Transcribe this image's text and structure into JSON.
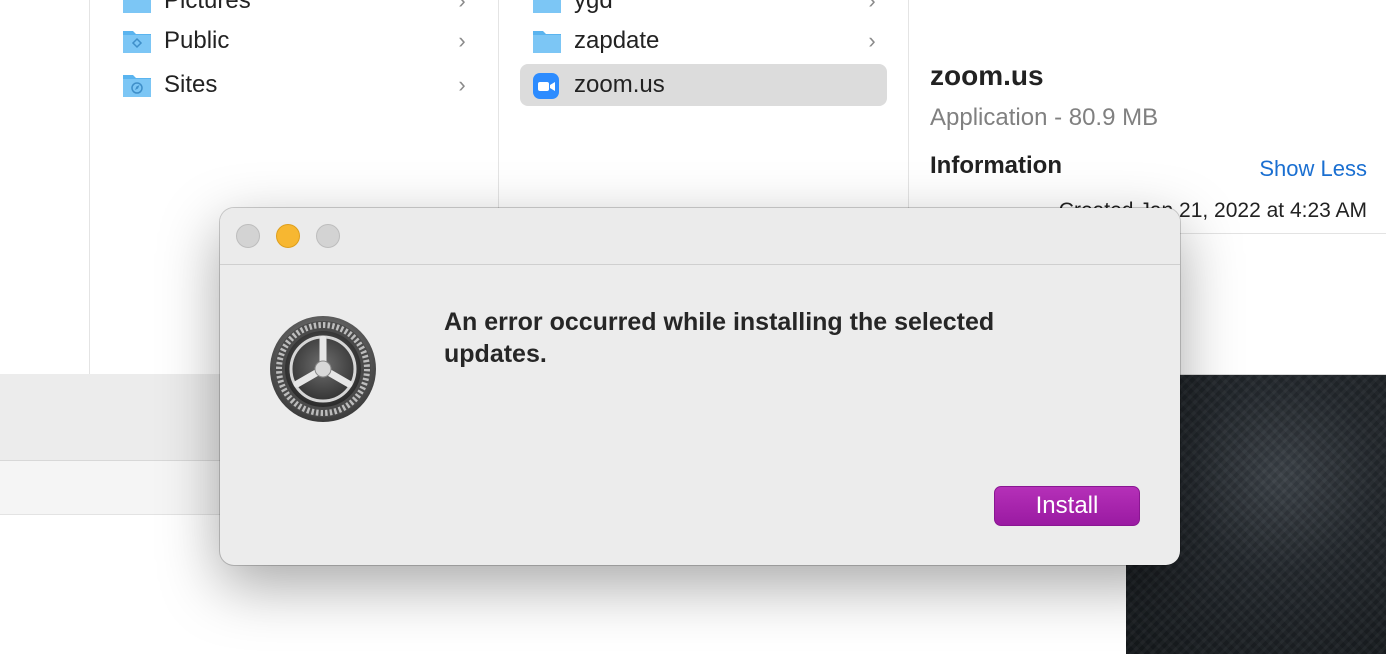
{
  "finder": {
    "column2": {
      "items": [
        {
          "label": "Pictures",
          "icon": "pictures-folder-icon"
        },
        {
          "label": "Public",
          "icon": "public-folder-icon"
        },
        {
          "label": "Sites",
          "icon": "sites-folder-icon"
        }
      ]
    },
    "column3": {
      "items": [
        {
          "label": "ygd",
          "icon": "folder-icon"
        },
        {
          "label": "zapdate",
          "icon": "folder-icon"
        },
        {
          "label": "zoom.us",
          "icon": "zoom-app-icon",
          "selected": true
        }
      ]
    },
    "preview": {
      "name": "zoom.us",
      "kind": "Application - 80.9 MB",
      "info_heading": "Information",
      "show_less": "Show Less",
      "created": "Created    Jan 21, 2022 at 4:23 AM"
    }
  },
  "dialog": {
    "message": "An error occurred while installing the selected updates.",
    "install_label": "Install",
    "icon": "system-preferences-gear-icon",
    "colors": {
      "install_button": "#a323aa",
      "minimize": "#f7b731"
    }
  }
}
